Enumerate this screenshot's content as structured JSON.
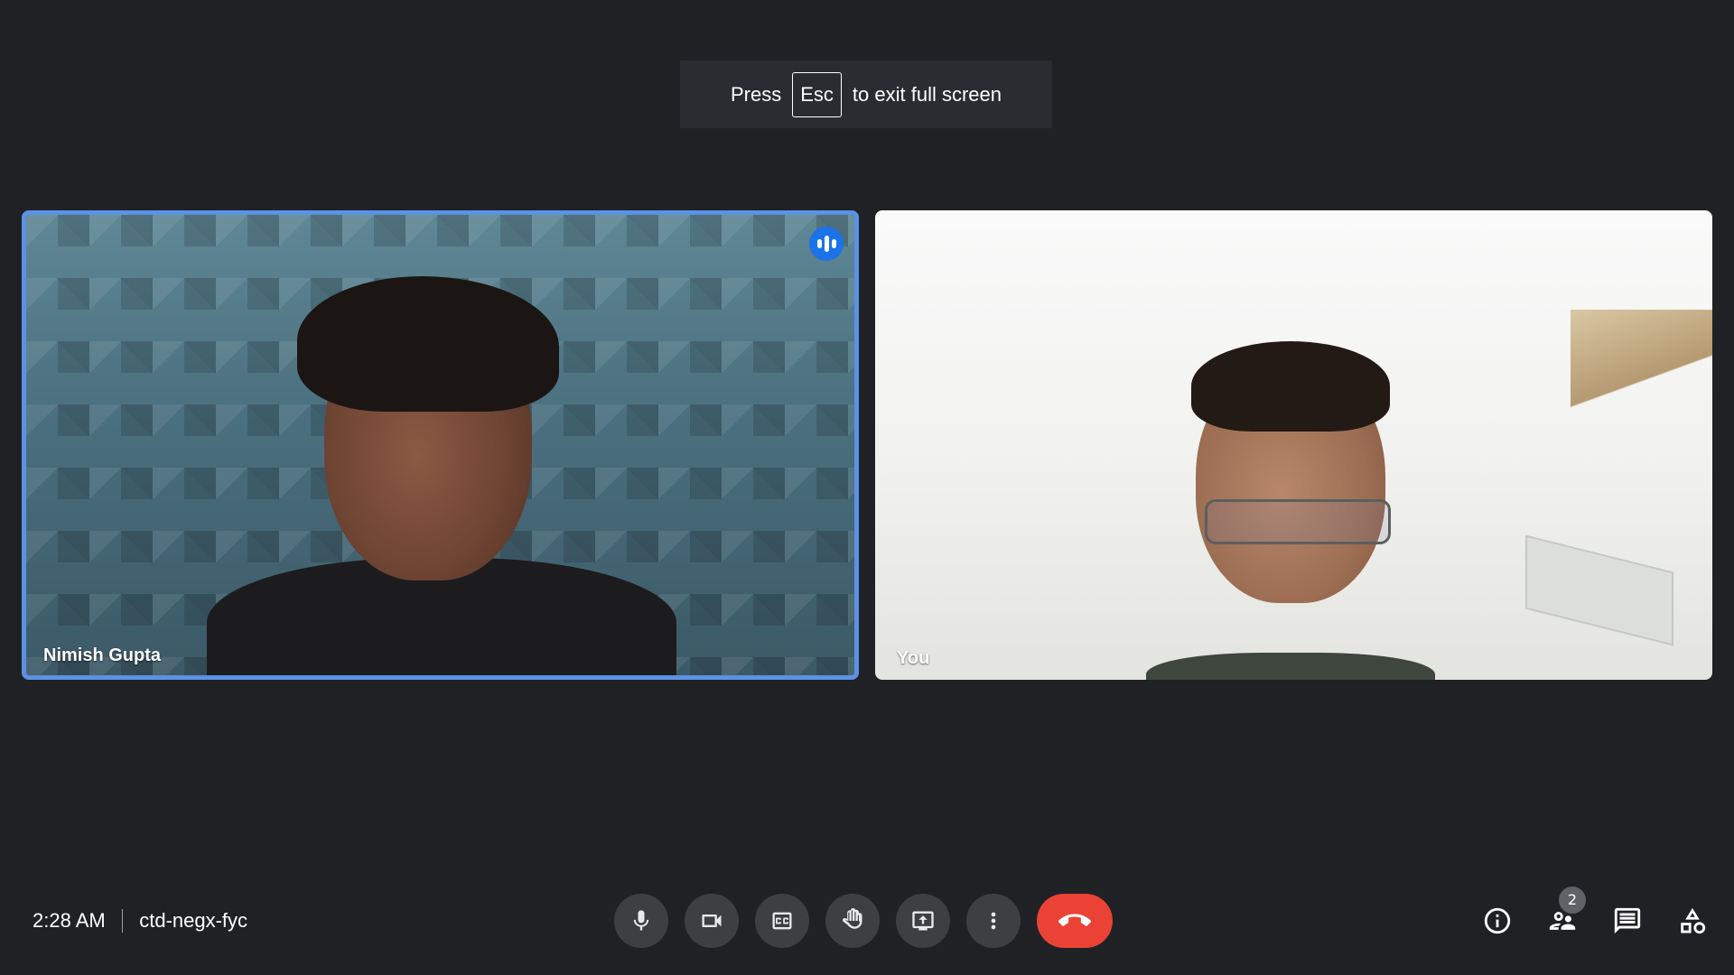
{
  "fullscreen_toast": {
    "before": "Press",
    "key": "Esc",
    "after": "to exit full screen"
  },
  "participants": [
    {
      "name": "Nimish Gupta",
      "speaking": true,
      "highlight_color": "#5b92e5"
    },
    {
      "name": "You",
      "speaking": false
    }
  ],
  "meeting": {
    "time": "2:28 AM",
    "code": "ctd-negx-fyc"
  },
  "controls": [
    {
      "name": "microphone",
      "icon": "mic-icon"
    },
    {
      "name": "camera",
      "icon": "videocam-icon"
    },
    {
      "name": "captions",
      "icon": "closed-caption-icon"
    },
    {
      "name": "raise-hand",
      "icon": "hand-icon"
    },
    {
      "name": "present",
      "icon": "present-screen-icon"
    },
    {
      "name": "more-options",
      "icon": "more-vert-icon"
    },
    {
      "name": "leave-call",
      "icon": "call-end-icon",
      "color": "#ea4335"
    }
  ],
  "side_controls": {
    "info_icon": "info-icon",
    "people_icon": "people-icon",
    "people_count": "2",
    "chat_icon": "chat-icon",
    "activities_icon": "activities-icon"
  },
  "colors": {
    "background": "#202124",
    "button": "#3c4043",
    "accent": "#1a73e8"
  }
}
